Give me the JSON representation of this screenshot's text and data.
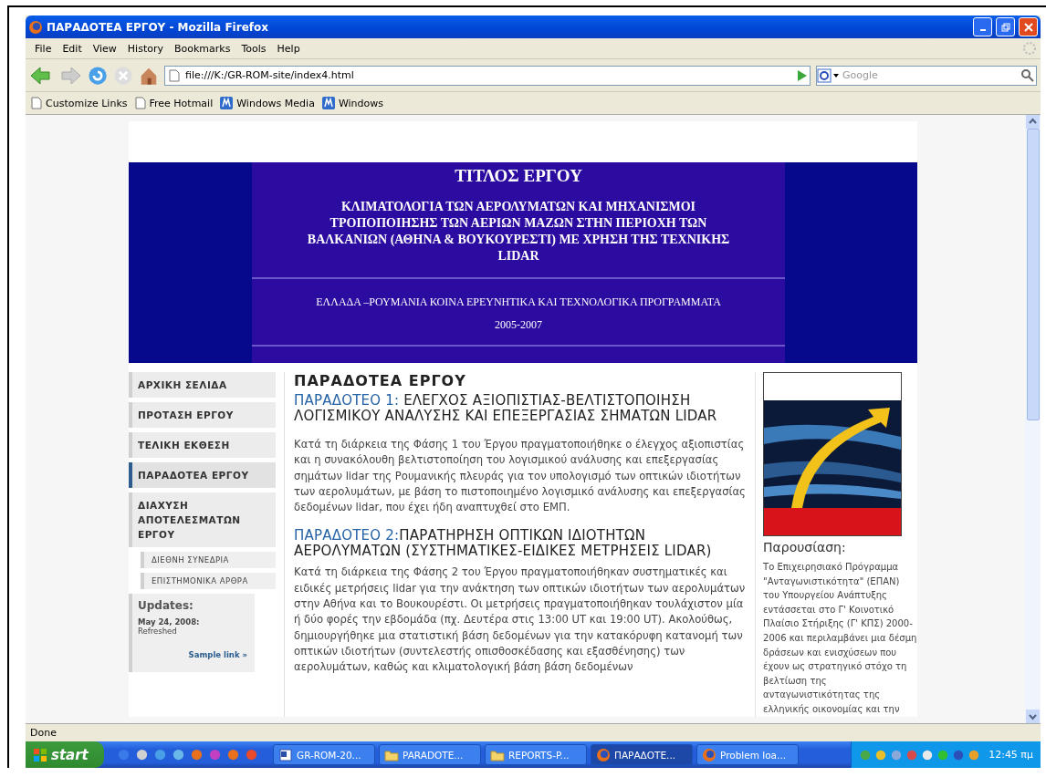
{
  "window": {
    "title": "ΠΑΡΑΔΟΤΕΑ ΕΡΓΟΥ - Mozilla Firefox"
  },
  "menu": [
    {
      "label": "File"
    },
    {
      "label": "Edit"
    },
    {
      "label": "View"
    },
    {
      "label": "History"
    },
    {
      "label": "Bookmarks"
    },
    {
      "label": "Tools"
    },
    {
      "label": "Help"
    }
  ],
  "toolbar": {
    "address": "file:///K:/GR-ROM-site/index4.html",
    "search": {
      "placeholder": "Google"
    }
  },
  "bookmarks": [
    {
      "label": "Customize Links",
      "kind": "page"
    },
    {
      "label": "Free Hotmail",
      "kind": "page"
    },
    {
      "label": "Windows Media",
      "kind": "media"
    },
    {
      "label": "Windows",
      "kind": "media"
    }
  ],
  "banner": {
    "heading": "ΤΙΤΛΟΣ ΕΡΓΟΥ",
    "title_lines": [
      "ΚΛΙΜΑΤΟΛΟΓΙΑ ΤΩΝ ΑΕΡΟΛΥΜΑΤΩΝ ΚΑΙ ΜΗΧΑΝΙΣΜΟΙ",
      "ΤΡΟΠΟΠΟΙΗΣΗΣ ΤΩΝ ΑΕΡΙΩΝ ΜΑΖΩΝ ΣΤΗΝ ΠΕΡΙΟΧΗ ΤΩΝ",
      "ΒΑΛΚΑΝΙΩΝ (ΑΘΗΝΑ & ΒΟΥΚΟΥΡΕΣΤΙ) ΜΕ ΧΡΗΣΗ ΤΗΣ ΤΕΧΝΙΚΗΣ",
      "LIDAR"
    ],
    "program": "ΕΛΛΑΔΑ –ΡΟΥΜΑΝΙΑ ΚΟΙΝΑ ΕΡΕΥΝΗΤΙΚΑ ΚΑΙ ΤΕΧΝΟΛΟΓΙΚΑ ΠΡΟΓΡΑΜΜΑΤΑ",
    "years": "2005-2007"
  },
  "nav": [
    {
      "label": "ΑΡΧΙΚΗ ΣΕΛΙΔΑ",
      "selected": false
    },
    {
      "label": "ΠΡΟΤΑΣΗ ΕΡΓΟΥ",
      "selected": false
    },
    {
      "label": "ΤΕΛΙΚΗ ΕΚΘΕΣΗ",
      "selected": false
    },
    {
      "label": "ΠΑΡΑΔΟΤΕΑ ΕΡΓΟΥ",
      "selected": true
    },
    {
      "label": "ΔΙΑΧΥΣΗ ΑΠΟΤΕΛΕΣΜΑΤΩΝ ΕΡΓΟΥ",
      "selected": false,
      "children": [
        {
          "label": "ΔΙΕΘΝΗ ΣΥΝΕΔΡΙΑ",
          "selected": false
        },
        {
          "label": "ΕΠΙΣΤΗΜΟΝΙΚΑ ΑΡΘΡΑ",
          "selected": false
        }
      ]
    }
  ],
  "updates": {
    "heading": "Updates:",
    "date": "May 24, 2008:",
    "text": "Refreshed",
    "link": "Sample link »"
  },
  "main": {
    "heading": "ΠΑΡΑΔΟΤΕΑ ΕΡΓΟΥ",
    "sections": [
      {
        "label": "ΠΑΡΑΔΟΤΕΟ 1:",
        "title": " ΕΛΕΓΧΟΣ ΑΞΙΟΠΙΣΤΙΑΣ-ΒΕΛΤΙΣΤΟΠΟΙΗΣΗ ΛΟΓΙΣΜΙΚΟΥ ΑΝΑΛΥΣΗΣ ΚΑΙ ΕΠΕΞΕΡΓΑΣΙΑΣ ΣΗΜΑΤΩΝ LIDAR",
        "body": "Κατά τη διάρκεια της Φάσης 1 του Έργου πραγματοποιήθηκε ο έλεγχος αξιοπιστίας και η συνακόλουθη βελτιστοποίηση του λογισμικού ανάλυσης και επεξεργασίας σημάτων lidar της Ρουμανικής πλευράς για τον υπολογισμό των οπτικών ιδιοτήτων των αερολυμάτων, με βάση το πιστοποιημένο λογισμικό ανάλυσης και επεξεργασίας δεδομένων lidar, που έχει ήδη αναπτυχθεί στο ΕΜΠ."
      },
      {
        "label": "ΠΑΡΑΔΟΤΕΟ 2:",
        "title": "ΠΑΡΑΤΗΡΗΣΗ ΟΠΤΙΚΩΝ ΙΔΙΟΤΗΤΩΝ ΑΕΡΟΛΥΜΑΤΩΝ (ΣΥΣΤΗΜΑΤΙΚΕΣ-ΕΙΔΙΚΕΣ ΜΕΤΡΗΣΕΙΣ LIDAR)",
        "body": "Κατά τη διάρκεια της Φάσης 2 του Έργου πραγματοποιήθηκαν συστηματικές και ειδικές μετρήσεις lidar για την ανάκτηση των οπτικών ιδιοτήτων των αερολυμάτων στην Αθήνα και το Βουκουρέστι. Οι μετρήσεις πραγματοποιήθηκαν τουλάχιστον μία ή δύο φορές την εβδομάδα (πχ. Δευτέρα στις 13:00 UT και 19:00 UT). Ακολούθως, δημιουργήθηκε μια στατιστική βάση δεδομένων για την κατακόρυφη κατανομή των οπτικών ιδιοτήτων (συντελεστής οπισθοσκέδασης και εξασθένησης) των αερολυμάτων, καθώς και κλιματολογική βάση βάση δεδομένων"
      }
    ]
  },
  "aside": {
    "heading": "Παρουσίαση:",
    "body": "Το Επιχειρησιακό Πρόγραμμα \"Ανταγωνιστικότητα\" (ΕΠΑΝ) του Υπουργείου Ανάπτυξης εντάσσεται στο Γ' Κοινοτικό Πλαίσιο Στήριξης (Γ' ΚΠΣ) 2000-2006 και περιλαμβάνει μια δέσμη δράσεων και ενισχύσεων που έχουν ως στρατηγικό στόχο τη βελτίωση της ανταγωνιστικότητας της ελληνικής οικονομίας και την"
  },
  "status": "Done",
  "taskbar": {
    "start": "start",
    "tasks": [
      {
        "label": "GR-ROM-20...",
        "kind": "word",
        "selected": false
      },
      {
        "label": "PARADOTE...",
        "kind": "folder",
        "selected": false
      },
      {
        "label": "REPORTS-P...",
        "kind": "folder",
        "selected": false
      },
      {
        "label": "ΠΑΡΑΔΟΤΕ...",
        "kind": "firefox",
        "selected": true
      },
      {
        "label": "Problem loa...",
        "kind": "firefox",
        "selected": false
      }
    ],
    "clock": "12:45 πμ"
  }
}
